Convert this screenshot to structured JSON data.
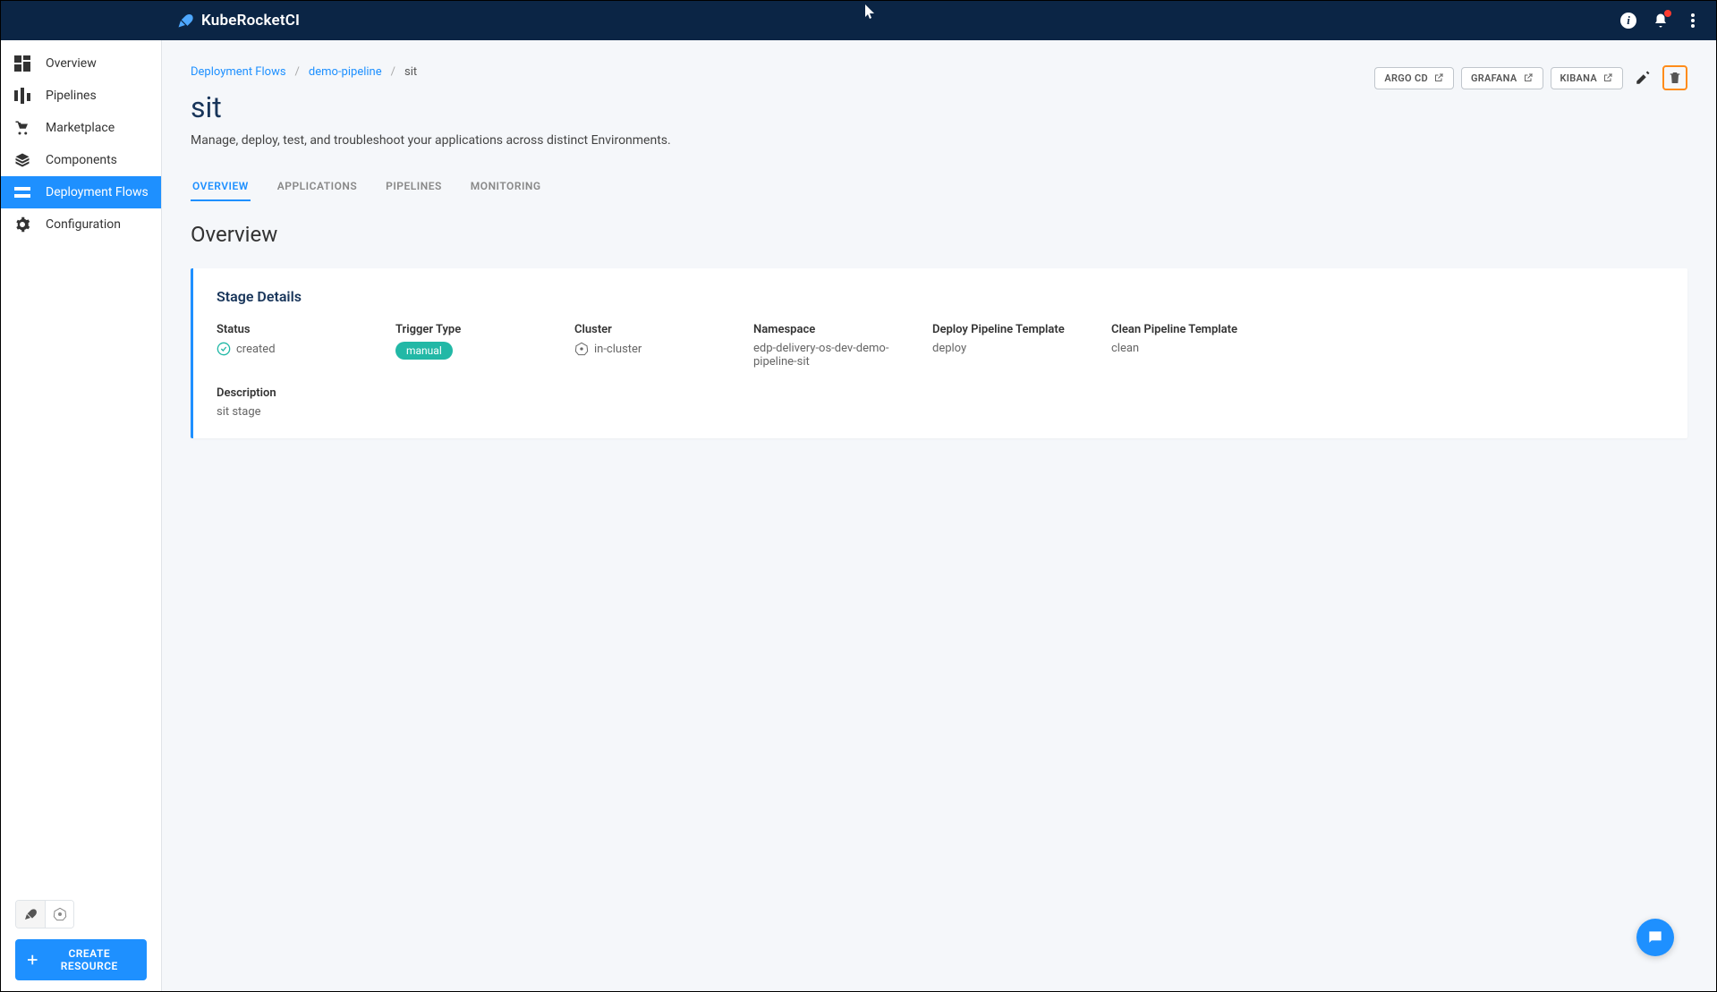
{
  "brand": "KubeRocketCI",
  "sidebar": {
    "items": [
      {
        "label": "Overview"
      },
      {
        "label": "Pipelines"
      },
      {
        "label": "Marketplace"
      },
      {
        "label": "Components"
      },
      {
        "label": "Deployment Flows"
      },
      {
        "label": "Configuration"
      }
    ],
    "create_btn": "CREATE RESOURCE"
  },
  "breadcrumb": {
    "items": [
      "Deployment Flows",
      "demo-pipeline",
      "sit"
    ]
  },
  "header_actions": {
    "argo": "ARGO CD",
    "grafana": "GRAFANA",
    "kibana": "KIBANA"
  },
  "page": {
    "title": "sit",
    "subtitle": "Manage, deploy, test, and troubleshoot your applications across distinct Environments."
  },
  "tabs": [
    "OVERVIEW",
    "APPLICATIONS",
    "PIPELINES",
    "MONITORING"
  ],
  "section_heading": "Overview",
  "card": {
    "title": "Stage Details",
    "status_label": "Status",
    "status_value": "created",
    "trigger_label": "Trigger Type",
    "trigger_value": "manual",
    "cluster_label": "Cluster",
    "cluster_value": "in-cluster",
    "namespace_label": "Namespace",
    "namespace_value": "edp-delivery-os-dev-demo-pipeline-sit",
    "deploy_template_label": "Deploy Pipeline Template",
    "deploy_template_value": "deploy",
    "clean_template_label": "Clean Pipeline Template",
    "clean_template_value": "clean",
    "description_label": "Description",
    "description_value": "sit stage"
  }
}
